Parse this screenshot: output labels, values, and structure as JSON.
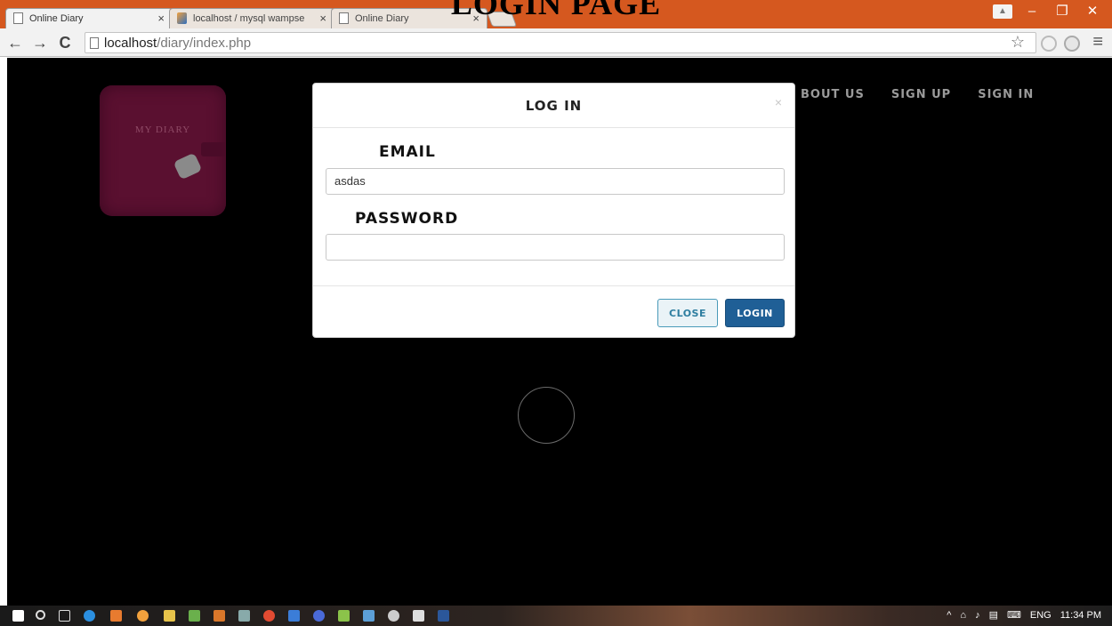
{
  "caption": "LOGIN PAGE",
  "browser": {
    "tabs": [
      {
        "title": "Online Diary",
        "active": true
      },
      {
        "title": "localhost / mysql wampse",
        "active": false
      },
      {
        "title": "Online Diary",
        "active": false
      }
    ],
    "url_host": "localhost",
    "url_path": "/diary/index.php"
  },
  "page": {
    "logo_text": "MY DIARY",
    "nav": [
      "BOUT US",
      "SIGN UP",
      "SIGN IN"
    ]
  },
  "modal": {
    "title": "LOG IN",
    "close_glyph": "×",
    "email_label": "EMAIL",
    "email_value": "asdas",
    "password_label": "PASSWORD",
    "password_value": "",
    "close_button": "CLOSE",
    "login_button": "LOGIN"
  },
  "taskbar": {
    "language": "ENG",
    "time": "11:34 PM"
  },
  "colors": {
    "tabbar": "#d5581f",
    "page_bg": "#000000",
    "login_button": "#1f5f96",
    "close_button_border": "#4a9ab9",
    "diary": "#5a1030"
  }
}
